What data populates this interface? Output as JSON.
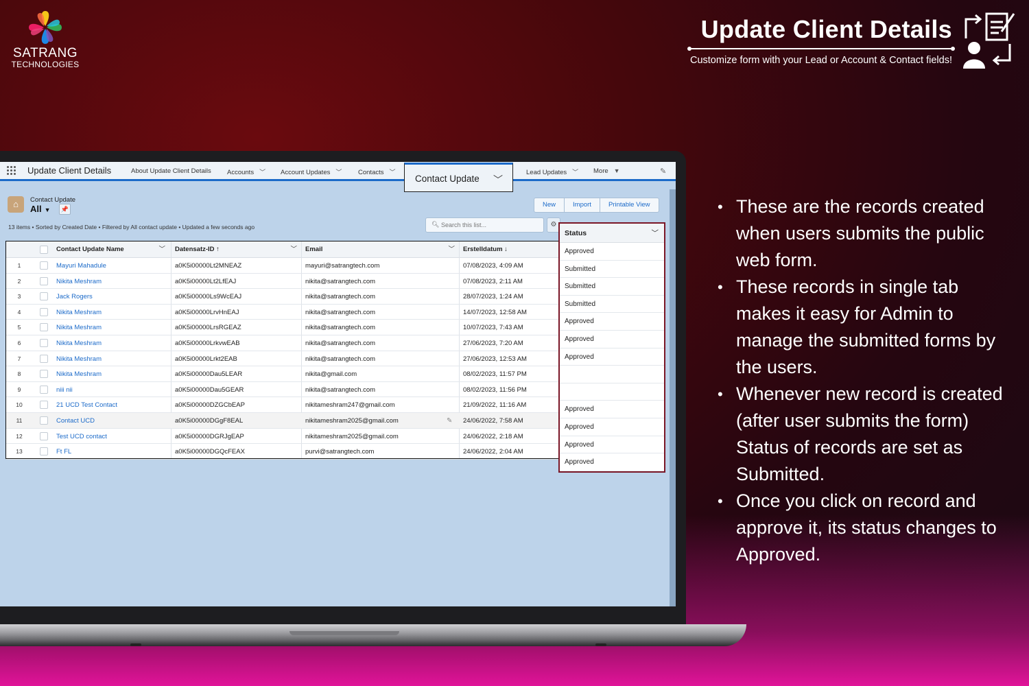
{
  "brand": {
    "line1": "SATRANG",
    "line2": "TECHNOLOGIES"
  },
  "header": {
    "title": "Update Client Details",
    "subtitle": "Customize form with your Lead or Account & Contact fields!",
    "icon": "form-update-icon"
  },
  "bullets": [
    "These are the records created when users submits the public web form.",
    "These records in single tab makes it easy for Admin to manage the submitted forms by the users.",
    "Whenever new record is created (after user submits the form) Status of records are set as  Submitted.",
    "Once you click on record and approve it, its status changes to Approved."
  ],
  "app": {
    "name": "Update Client Details",
    "nav": {
      "about": "About Update Client Details",
      "accounts": "Accounts",
      "account_updates": "Account Updates",
      "contacts": "Contacts",
      "active_tab": "Contact Update",
      "lead_updates": "Lead Updates",
      "more": "More"
    }
  },
  "list_view": {
    "object": "Contact Update",
    "name": "All",
    "meta": "13 items • Sorted by Created Date • Filtered by All contact update • Updated a few seconds ago",
    "buttons": {
      "new": "New",
      "import": "Import",
      "printable": "Printable View"
    },
    "search_placeholder": "Search this list..."
  },
  "table": {
    "columns": {
      "name": "Contact Update Name",
      "id": "Datensatz-ID ↑",
      "email": "Email",
      "date": "Erstelldatum ↓",
      "status": "Status"
    },
    "rows": [
      {
        "n": "1",
        "name": "Mayuri Mahadule",
        "id": "a0K5i00000Lt2MNEAZ",
        "email": "mayuri@satrangtech.com",
        "date": "07/08/2023, 4:09 AM",
        "status": "Approved"
      },
      {
        "n": "2",
        "name": "Nikita Meshram",
        "id": "a0K5i00000Lt2LfEAJ",
        "email": "nikita@satrangtech.com",
        "date": "07/08/2023, 2:11 AM",
        "status": "Submitted"
      },
      {
        "n": "3",
        "name": "Jack Rogers",
        "id": "a0K5i00000Ls9WcEAJ",
        "email": "nikita@satrangtech.com",
        "date": "28/07/2023, 1:24 AM",
        "status": "Submitted"
      },
      {
        "n": "4",
        "name": "Nikita Meshram",
        "id": "a0K5i00000LrvHnEAJ",
        "email": "nikita@satrangtech.com",
        "date": "14/07/2023, 12:58 AM",
        "status": "Submitted"
      },
      {
        "n": "5",
        "name": "Nikita Meshram",
        "id": "a0K5i00000LrsRGEAZ",
        "email": "nikita@satrangtech.com",
        "date": "10/07/2023, 7:43 AM",
        "status": "Approved"
      },
      {
        "n": "6",
        "name": "Nikita Meshram",
        "id": "a0K5i00000LrkvwEAB",
        "email": "nikita@satrangtech.com",
        "date": "27/06/2023, 7:20 AM",
        "status": "Approved"
      },
      {
        "n": "7",
        "name": "Nikita Meshram",
        "id": "a0K5i00000Lrkt2EAB",
        "email": "nikita@satrangtech.com",
        "date": "27/06/2023, 12:53 AM",
        "status": "Approved"
      },
      {
        "n": "8",
        "name": "Nikita Meshram",
        "id": "a0K5i00000Dau5LEAR",
        "email": "nikita@gmail.com",
        "date": "08/02/2023, 11:57 PM",
        "status": ""
      },
      {
        "n": "9",
        "name": "niii nii",
        "id": "a0K5i00000Dau5GEAR",
        "email": "nikita@satrangtech.com",
        "date": "08/02/2023, 11:56 PM",
        "status": ""
      },
      {
        "n": "10",
        "name": "21 UCD Test Contact",
        "id": "a0K5i00000DZGCbEAP",
        "email": "nikitameshram247@gmail.com",
        "date": "21/09/2022, 11:16 AM",
        "status": "Approved"
      },
      {
        "n": "11",
        "name": "Contact UCD",
        "id": "a0K5i00000DGgF8EAL",
        "email": "nikitameshram2025@gmail.com",
        "date": "24/06/2022, 7:58 AM",
        "status": "Approved"
      },
      {
        "n": "12",
        "name": "Test UCD contact",
        "id": "a0K5i00000DGRJgEAP",
        "email": "nikitameshram2025@gmail.com",
        "date": "24/06/2022, 2:18 AM",
        "status": "Approved"
      },
      {
        "n": "13",
        "name": "Ft FL",
        "id": "a0K5i00000DGQcFEAX",
        "email": "purvi@satrangtech.com",
        "date": "24/06/2022, 2:04 AM",
        "status": "Approved"
      }
    ]
  }
}
